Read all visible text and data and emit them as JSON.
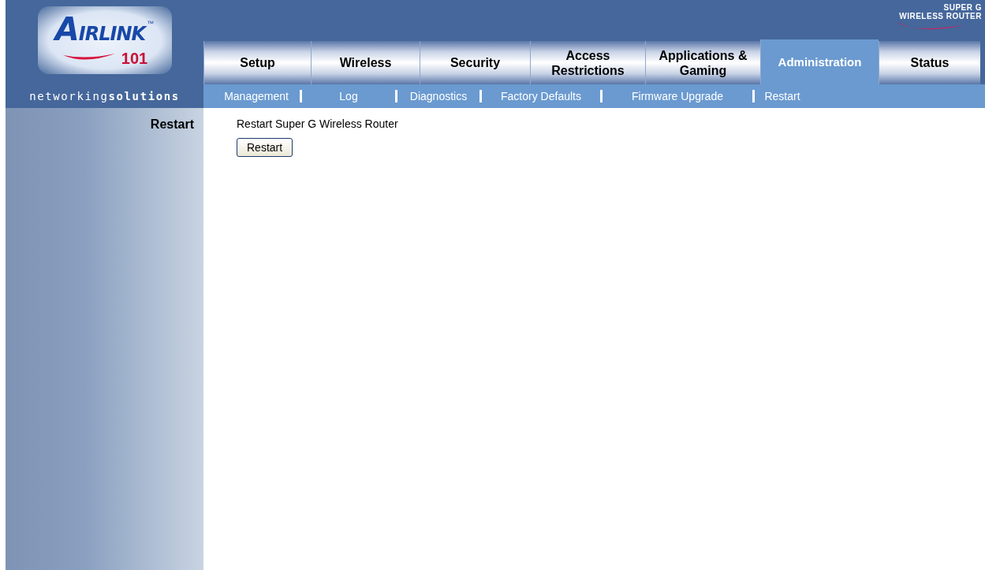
{
  "logo": {
    "brand": "AIRLINK",
    "trademark": "™",
    "number": "101",
    "tagline": "networking**solutions**"
  },
  "product_badge": {
    "line_1": "SUPER G",
    "line_2": "WIRELESS ROUTER"
  },
  "tabs": [
    {
      "label": "Setup",
      "selected": false
    },
    {
      "label": "Wireless",
      "selected": false
    },
    {
      "label": "Security",
      "selected": false
    },
    {
      "label": "Access Restrictions",
      "selected": false
    },
    {
      "label": "Applications & Gaming",
      "selected": false
    },
    {
      "label": "Administration",
      "selected": true
    },
    {
      "label": "Status",
      "selected": false
    }
  ],
  "subtabs": [
    {
      "label": "Management",
      "selected": false
    },
    {
      "label": "Log",
      "selected": false
    },
    {
      "label": "Diagnostics",
      "selected": false
    },
    {
      "label": "Factory Defaults",
      "selected": false
    },
    {
      "label": "Firmware Upgrade",
      "selected": false
    },
    {
      "label": "Restart",
      "selected": false
    }
  ],
  "section": {
    "title": "Restart",
    "description": "Restart Super G Wireless Router",
    "button": "Restart"
  }
}
